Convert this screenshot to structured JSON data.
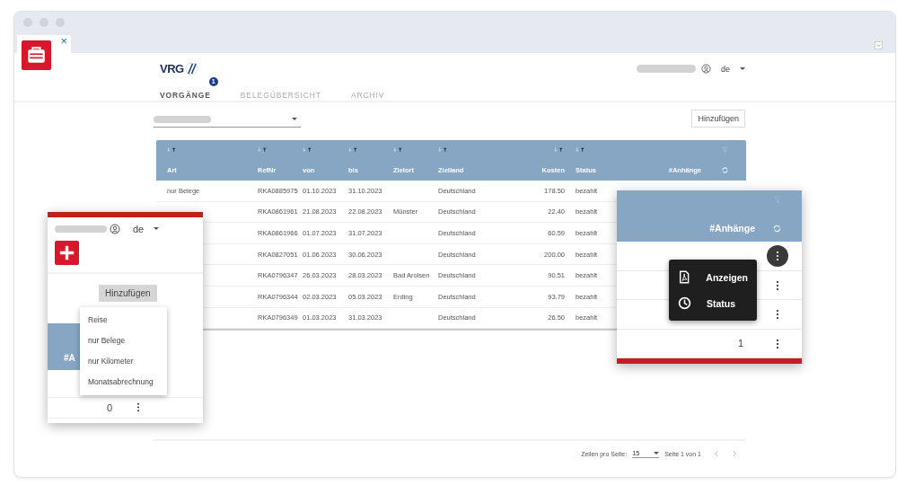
{
  "browser": {
    "tab_close": "×"
  },
  "app": {
    "logo": "VRG",
    "tabs": [
      {
        "label": "VORGÄNGE",
        "selected": true,
        "badge": "1"
      },
      {
        "label": "BELEGÜBERSICHT",
        "selected": false
      },
      {
        "label": "ARCHIV",
        "selected": false
      }
    ],
    "language": "de"
  },
  "toolbar": {
    "add_button": "Hinzufügen"
  },
  "table": {
    "columns": [
      {
        "label": "Art",
        "sortable": true
      },
      {
        "label": "RefNr",
        "sortable": true
      },
      {
        "label": "von",
        "sortable": true
      },
      {
        "label": "bis",
        "sortable": true
      },
      {
        "label": "Zielort",
        "sortable": true
      },
      {
        "label": "Zielland",
        "sortable": true
      },
      {
        "label": "Kosten",
        "sortable": true
      },
      {
        "label": "Status",
        "sortable": true
      },
      {
        "label": "#Anhänge",
        "sortable": false
      }
    ],
    "rows": [
      {
        "art": "nur Belege",
        "refnr": "RKA0885975",
        "von": "01.10.2023",
        "bis": "31.10.2023",
        "zielland": "Deutschland",
        "kosten": "178.50",
        "status": "bezahlt"
      },
      {
        "refnr": "RKA0861961",
        "von": "21.08.2023",
        "bis": "22.08.2023",
        "zielort": "Münster",
        "zielland": "Deutschland",
        "kosten": "22.40",
        "status": "bezahlt"
      },
      {
        "refnr": "RKA0861966",
        "von": "01.07.2023",
        "bis": "31.07.2023",
        "zielland": "Deutschland",
        "kosten": "60.59",
        "status": "bezahlt"
      },
      {
        "refnr": "RKA0827051",
        "von": "01.06.2023",
        "bis": "30.06.2023",
        "zielland": "Deutschland",
        "kosten": "200.00",
        "status": "bezahlt"
      },
      {
        "refnr": "RKA0796347",
        "von": "26.03.2023",
        "bis": "28.03.2023",
        "zielort": "Bad Arolsen",
        "zielland": "Deutschland",
        "kosten": "90.51",
        "status": "bezahlt"
      },
      {
        "refnr": "RKA0796344",
        "von": "02.03.2023",
        "bis": "05.03.2023",
        "zielort": "Erding",
        "zielland": "Deutschland",
        "kosten": "93.79",
        "status": "bezahlt"
      },
      {
        "refnr": "RKA0796349",
        "von": "01.03.2023",
        "bis": "31.03.2023",
        "zielland": "Deutschland",
        "kosten": "26.50",
        "status": "bezahlt"
      }
    ]
  },
  "pagination": {
    "rows_label": "Zeilen pro Seite:",
    "rows_value": "15",
    "page": "Seite 1 von 1"
  },
  "zoom_left": {
    "language": "de",
    "add_button": "Hinzufügen",
    "menu": [
      "Reise",
      "nur Belege",
      "nur Kilometer",
      "Monatsabrechnung"
    ],
    "column_label": "#A",
    "row_value": "0"
  },
  "zoom_right": {
    "column_label": "#Anhänge",
    "rows": [
      {
        "selected": true
      },
      {
        "selected": false
      },
      {
        "selected": false
      },
      {
        "value": "1",
        "selected": false
      }
    ],
    "menu": [
      {
        "kind": "pdf",
        "label": "Anzeigen"
      },
      {
        "kind": "clock",
        "label": "Status"
      }
    ]
  }
}
